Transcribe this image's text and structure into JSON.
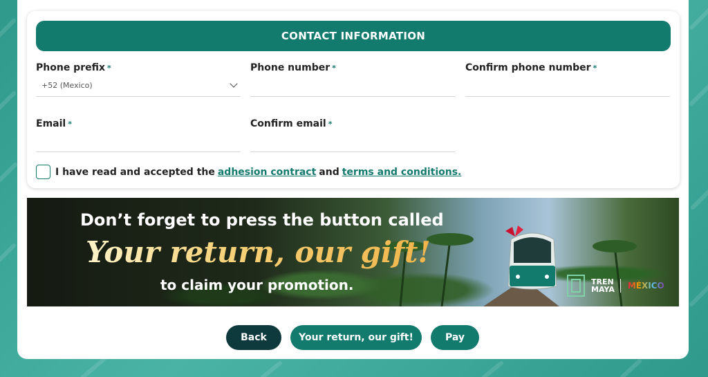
{
  "contact": {
    "header": "CONTACT INFORMATION",
    "required_mark": "*",
    "fields": {
      "phone_prefix": {
        "label": "Phone prefix",
        "value": "+52 (Mexico)"
      },
      "phone_number": {
        "label": "Phone number",
        "value": ""
      },
      "confirm_phone": {
        "label": "Confirm phone number",
        "value": ""
      },
      "email": {
        "label": "Email",
        "value": ""
      },
      "confirm_email": {
        "label": "Confirm email",
        "value": ""
      }
    },
    "terms": {
      "text_before": "I have read and accepted the",
      "link1": "adhesion contract",
      "text_mid": "and",
      "link2": "terms and conditions."
    }
  },
  "banner": {
    "line1": "Don’t forget to press the button called",
    "line2": "Your return, our gift!",
    "line3": "to claim your promotion.",
    "logo_tren": "TREN",
    "logo_maya": "MAYA",
    "logo_mexico": "MÉXICO"
  },
  "actions": {
    "back": "Back",
    "gift": "Your return, our gift!",
    "pay": "Pay"
  },
  "colors": {
    "primary": "#137a6e",
    "dark": "#0f3a3d"
  }
}
